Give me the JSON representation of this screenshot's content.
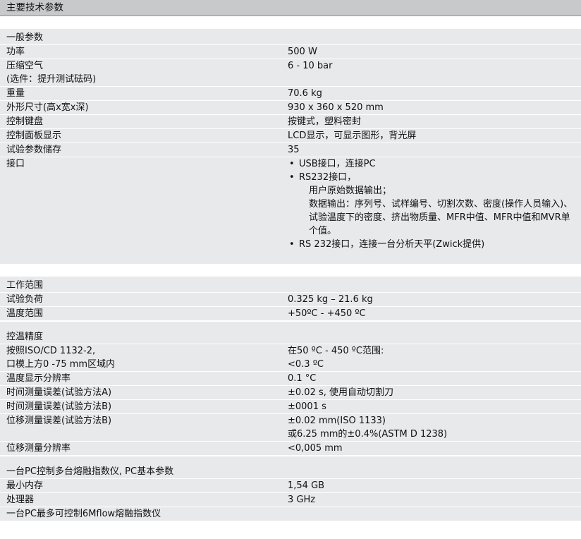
{
  "title": "主要技术参数",
  "general": {
    "heading": "一般参数",
    "rows": [
      {
        "k": [
          "功率"
        ],
        "v": "500 W"
      },
      {
        "k": [
          "压缩空气",
          "(选件：提升测试砝码)"
        ],
        "v": "6 - 10 bar"
      },
      {
        "k": [
          "重量"
        ],
        "v": "70.6 kg"
      },
      {
        "k": [
          "外形尺寸(高x宽x深)"
        ],
        "v": "930 x 360 x 520 mm"
      },
      {
        "k": [
          "控制键盘"
        ],
        "v": "按键式，塑料密封"
      },
      {
        "k": [
          "控制面板显示"
        ],
        "v": "LCD显示，可显示图形，背光屏"
      },
      {
        "k": [
          "试验参数储存"
        ],
        "v": "35"
      }
    ],
    "interface": {
      "k": "接口",
      "b1": "USB接口，连接PC",
      "b2": "RS232接口，",
      "b2_l1": "用户原始数据输出；",
      "b2_l2": "数据输出：序列号、试样编号、切割次数、密度(操作人员输入)、试验温度下的密度、挤出物质量、MFR中值、MFR中值和MVR单个值。",
      "b3": "RS 232接口，连接一台分析天平(Zwick提供)"
    }
  },
  "range": {
    "heading": "工作范围",
    "rows": [
      {
        "k": [
          "试验负荷"
        ],
        "v": "0.325 kg – 21.6 kg"
      },
      {
        "k": [
          "温度范围"
        ],
        "v": "+50ºC - +450 ºC"
      }
    ]
  },
  "accuracy": {
    "heading": "控温精度",
    "rows": [
      {
        "k": [
          "按照ISO/CD 1132-2,",
          "口模上方0 -75 mm区域内"
        ],
        "v": [
          "在50 ºC - 450 ºC范围:",
          "<0.3 ºC"
        ]
      },
      {
        "k": [
          "温度显示分辨率"
        ],
        "v": [
          "0.1 °C"
        ]
      },
      {
        "k": [
          "时间测量误差(试验方法A)"
        ],
        "v": [
          "±0.02 s, 使用自动切割刀"
        ]
      },
      {
        "k": [
          "时间测量误差(试验方法B)"
        ],
        "v": [
          "±0001 s"
        ]
      },
      {
        "k": [
          "位移测量误差(试验方法B)"
        ],
        "v": [
          "±0.02 mm(ISO 1133)",
          "或6.25 mm的±0.4%(ASTM D 1238)"
        ]
      },
      {
        "k": [
          "位移测量分辨率"
        ],
        "v": [
          "<0,005 mm"
        ]
      }
    ]
  },
  "pc": {
    "heading": "一台PC控制多台熔融指数仪, PC基本参数",
    "rows": [
      {
        "k": [
          "最小内存"
        ],
        "v": "1,54 GB"
      },
      {
        "k": [
          "处理器"
        ],
        "v": "3 GHz"
      }
    ],
    "footer": "一台PC最多可控制6Mflow熔融指数仪"
  }
}
